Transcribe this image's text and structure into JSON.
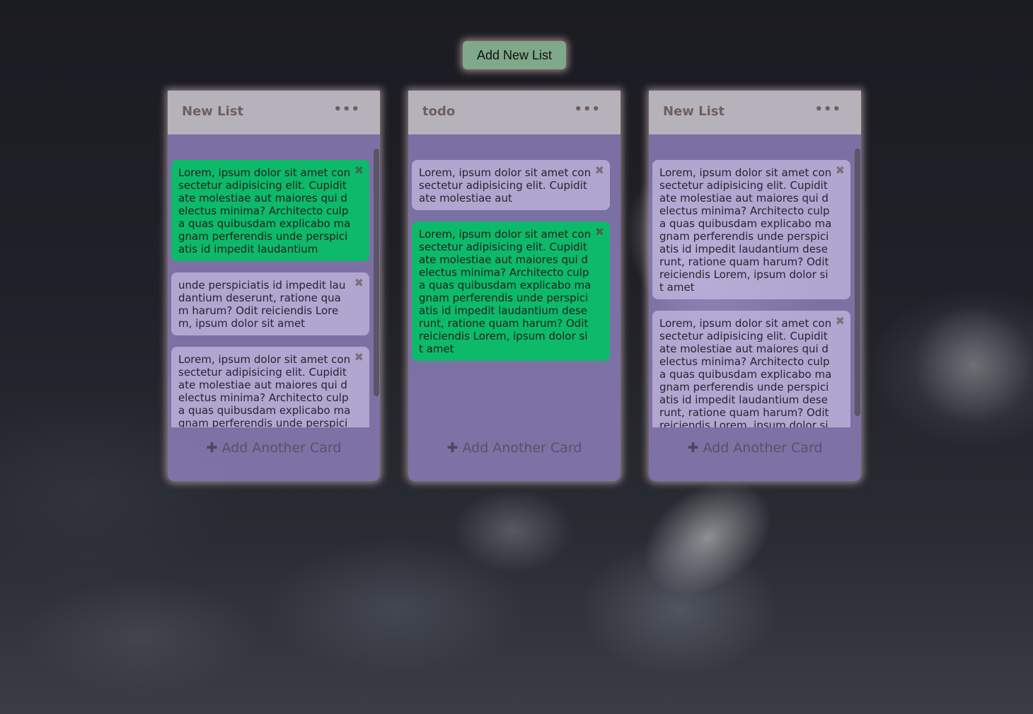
{
  "toolbar": {
    "add_list_label": "Add New List"
  },
  "lists": [
    {
      "title": "New List",
      "menu_label": "•••",
      "add_card_icon": "✚",
      "add_card_label": "Add Another Card",
      "cards": [
        {
          "text": "Lorem, ipsum dolor sit amet consectetur adipisicing elit. Cupiditate molestiae aut maiores qui delectus minima? Architecto culpa quas quibusdam explicabo magnam perferendis unde perspiciatis id impedit laudantium",
          "highlight": true,
          "close": "✖"
        },
        {
          "text": "unde perspiciatis id impedit laudantium deserunt, ratione quam harum? Odit reiciendis Lorem, ipsum dolor sit amet",
          "highlight": false,
          "close": "✖"
        },
        {
          "text": "Lorem, ipsum dolor sit amet consectetur adipisicing elit. Cupiditate molestiae aut maiores qui delectus minima? Architecto culpa quas quibusdam explicabo magnam perferendis unde perspiciatis id impedit laudantium deserunt, ratione quam harum? Odit reiciendis Lorem, ipsum dolor sit amet",
          "highlight": false,
          "close": "✖"
        }
      ]
    },
    {
      "title": "todo",
      "menu_label": "•••",
      "add_card_icon": "✚",
      "add_card_label": "Add Another Card",
      "cards": [
        {
          "text": "Lorem, ipsum dolor sit amet consectetur adipisicing elit. Cupiditate molestiae aut",
          "highlight": false,
          "close": "✖"
        },
        {
          "text": "Lorem, ipsum dolor sit amet consectetur adipisicing elit. Cupiditate molestiae aut maiores qui delectus minima? Architecto culpa quas quibusdam explicabo magnam perferendis unde perspiciatis id impedit laudantium deserunt, ratione quam harum? Odit reiciendis Lorem, ipsum dolor sit amet",
          "highlight": true,
          "close": "✖"
        }
      ]
    },
    {
      "title": "New List",
      "menu_label": "•••",
      "add_card_icon": "✚",
      "add_card_label": "Add Another Card",
      "cards": [
        {
          "text": "Lorem, ipsum dolor sit amet consectetur adipisicing elit. Cupiditate molestiae aut maiores qui delectus minima? Architecto culpa quas quibusdam explicabo magnam perferendis unde perspiciatis id impedit laudantium deserunt, ratione quam harum? Odit reiciendis Lorem, ipsum dolor sit amet",
          "highlight": false,
          "close": "✖"
        },
        {
          "text": "Lorem, ipsum dolor sit amet consectetur adipisicing elit. Cupiditate molestiae aut maiores qui delectus minima? Architecto culpa quas quibusdam explicabo magnam perferendis unde perspiciatis id impedit laudantium deserunt, ratione quam harum? Odit reiciendis Lorem, ipsum dolor sit amet",
          "highlight": false,
          "close": "✖"
        }
      ]
    }
  ],
  "colors": {
    "card_highlight": "#0dba6a",
    "list_body": "#9687c8",
    "list_header": "#b6b2bb",
    "add_list_button": "#7fa98a"
  }
}
